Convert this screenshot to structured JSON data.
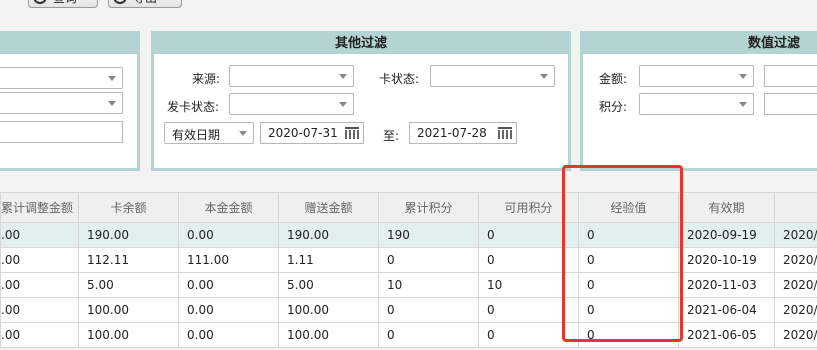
{
  "toolbar": {
    "buttons": [
      {
        "label": "查询"
      },
      {
        "label": "导出"
      }
    ]
  },
  "panels": {
    "other_filter": {
      "title": "其他过滤",
      "source_label": "来源:",
      "source_value": "",
      "card_status_label": "卡状态:",
      "card_status_value": "",
      "issue_status_label": "发卡状态:",
      "issue_status_value": "",
      "date_type_value": "有效日期",
      "date_from": "2020-07-31",
      "to_label": "至:",
      "date_to": "2021-07-28"
    },
    "numeric_filter": {
      "title": "数值过滤",
      "amount_label": "金额:",
      "points_label": "积分:"
    }
  },
  "table": {
    "columns": [
      "累计调整金额",
      "卡余额",
      "本金金额",
      "赠送金额",
      "累计积分",
      "可用积分",
      "经验值",
      "有效期",
      ""
    ],
    "rows": [
      [
        ".00",
        "190.00",
        "0.00",
        "190.00",
        "190",
        "0",
        "0",
        "2020-09-19",
        "2020/"
      ],
      [
        ".00",
        "112.11",
        "111.00",
        "1.11",
        "0",
        "0",
        "0",
        "2020-10-19",
        "2020/"
      ],
      [
        ".00",
        "5.00",
        "0.00",
        "5.00",
        "10",
        "10",
        "0",
        "2020-11-03",
        "2020/"
      ],
      [
        ".00",
        "100.00",
        "0.00",
        "100.00",
        "0",
        "0",
        "0",
        "2021-06-04",
        "2020/"
      ],
      [
        ".00",
        "100.00",
        "0.00",
        "100.00",
        "0",
        "0",
        "0",
        "2021-06-05",
        "2020/"
      ]
    ],
    "selected_row": 0
  },
  "highlight": {
    "color": "#e8342a",
    "target": "经验值"
  }
}
